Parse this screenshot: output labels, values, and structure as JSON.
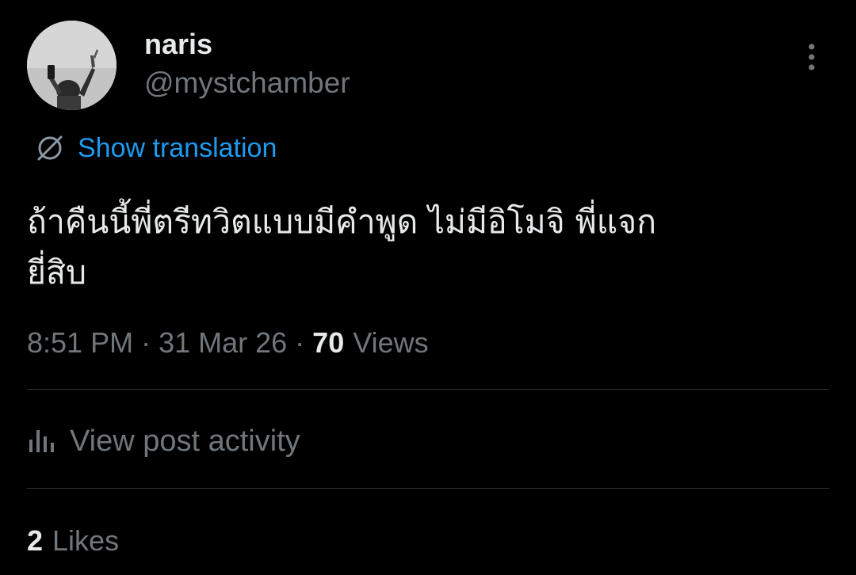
{
  "user": {
    "display_name": "naris",
    "handle": "@mystchamber"
  },
  "translation": {
    "label": "Show translation"
  },
  "tweet": {
    "line1": "ถ้าคืนนี้พี่ตรีทวิตแบบมีคำพูด ไม่มีอิโมจิ พี่แจก",
    "line2": "ยี่สิบ"
  },
  "meta": {
    "time": "8:51 PM",
    "separator": "·",
    "date": "31 Mar 26",
    "views_count": "70",
    "views_label": "Views"
  },
  "activity": {
    "label": "View post activity"
  },
  "likes": {
    "count": "2",
    "label": "Likes"
  },
  "icons": {
    "more": "more-vertical-icon",
    "translate": "globe-translate-icon",
    "activity": "bar-chart-icon"
  },
  "colors": {
    "background": "#000000",
    "primary_text": "#e7e9ea",
    "secondary_text": "#71767b",
    "accent": "#1d9bf0",
    "divider": "#2f3336"
  }
}
